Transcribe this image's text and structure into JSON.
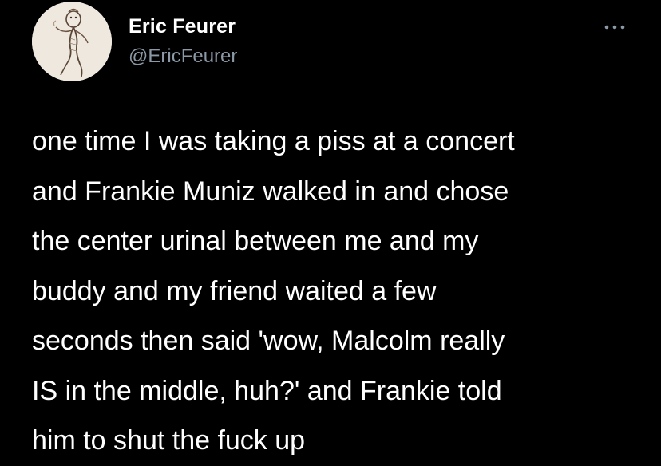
{
  "tweet": {
    "author": {
      "display_name": "Eric Feurer",
      "handle": "@EricFeurer",
      "avatar_icon": "sketch-figure-avatar"
    },
    "more_icon": "ellipsis-icon",
    "text_lines": [
      "one time I was taking a piss at a concert",
      "and Frankie Muniz walked in and chose",
      "the center urinal between me and my",
      "buddy and my friend waited a few",
      "seconds then said 'wow, Malcolm really",
      "IS in the middle, huh?' and Frankie told",
      "him to shut the fuck up"
    ]
  },
  "colors": {
    "background": "#000000",
    "text": "#ffffff",
    "secondary_text": "#8b98a5"
  }
}
